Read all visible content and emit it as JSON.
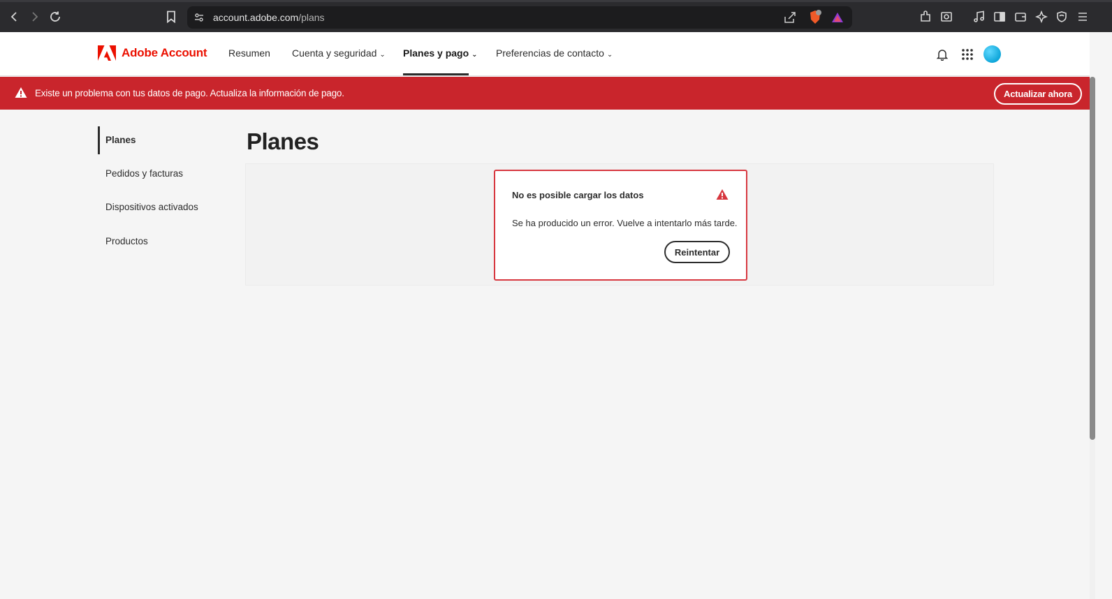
{
  "browser": {
    "url_host": "account.adobe.com",
    "url_path": "/plans"
  },
  "header": {
    "logo_text": "Adobe Account",
    "nav": [
      {
        "label": "Resumen"
      },
      {
        "label": "Cuenta y seguridad"
      },
      {
        "label": "Planes y pago"
      },
      {
        "label": "Preferencias de contacto"
      }
    ]
  },
  "alert": {
    "message": "Existe un problema con tus datos de pago. Actualiza la información de pago.",
    "button_label": "Actualizar ahora"
  },
  "sidebar": {
    "items": [
      {
        "label": "Planes"
      },
      {
        "label": "Pedidos y facturas"
      },
      {
        "label": "Dispositivos activados"
      },
      {
        "label": "Productos"
      }
    ]
  },
  "main": {
    "title": "Planes",
    "error": {
      "title": "No es posible cargar los datos",
      "message": "Se ha producido un error. Vuelve a intentarlo más tarde.",
      "retry_label": "Reintentar"
    }
  },
  "colors": {
    "brand_red": "#eb1000",
    "alert_bg": "#c9252c",
    "error_border": "#d7373f"
  }
}
